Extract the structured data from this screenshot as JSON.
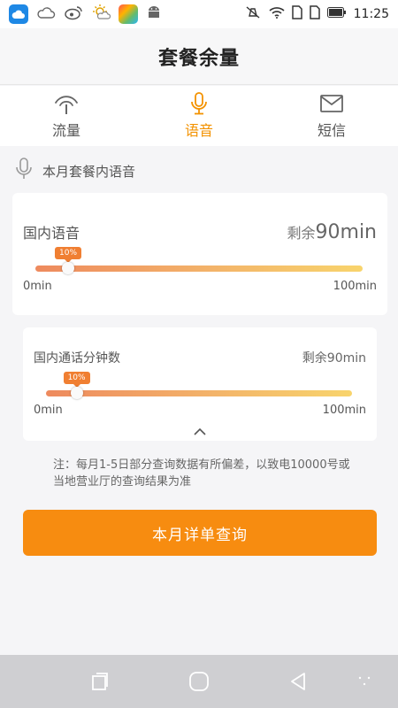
{
  "status_bar": {
    "time": "11:25",
    "icons": [
      "cloud-app-icon",
      "weather-icon",
      "weibo-icon",
      "sun-icon",
      "app-store-icon",
      "android-icon",
      "mute-vibrate-icon",
      "wifi-icon",
      "sim-icon",
      "sim-icon",
      "battery-icon"
    ]
  },
  "header": {
    "title": "套餐余量"
  },
  "tabs": [
    {
      "label": "流量",
      "icon": "signal-icon",
      "active": false
    },
    {
      "label": "语音",
      "icon": "microphone-icon",
      "active": true
    },
    {
      "label": "短信",
      "icon": "envelope-icon",
      "active": false
    }
  ],
  "section": {
    "title": "本月套餐内语音",
    "icon": "microphone-icon"
  },
  "cards": [
    {
      "label": "国内语音",
      "remain_prefix": "剩余",
      "remain_value": "90min",
      "used_percent": 10,
      "tag": "10%",
      "scale_min": "0min",
      "scale_max": "100min"
    },
    {
      "label": "国内通话分钟数",
      "remain_prefix": "剩余",
      "remain_value": "90min",
      "used_percent": 10,
      "tag": "10%",
      "scale_min": "0min",
      "scale_max": "100min"
    }
  ],
  "note": "注：每月1-5日部分查询数据有所偏差，以致电10000号或当地营业厅的查询结果为准",
  "button": {
    "label": "本月详单查询"
  },
  "colors": {
    "accent": "#f78c10",
    "active_tab": "#f39200"
  },
  "nav": {
    "icons": [
      "recent-apps-icon",
      "home-icon",
      "back-icon",
      "menu-dots-icon"
    ]
  }
}
